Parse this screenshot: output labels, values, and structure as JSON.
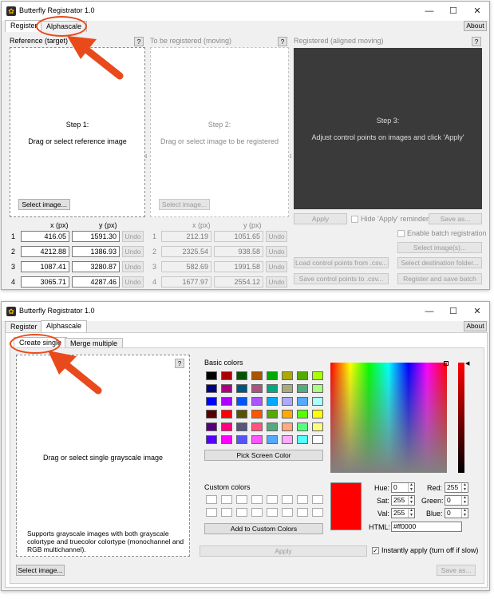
{
  "top": {
    "title": "Butterfly Registrator 1.0",
    "tabs": [
      "Register",
      "Alphascale"
    ],
    "about": "About",
    "help": "?",
    "panels": {
      "reference": {
        "label": "Reference (target)",
        "step": "Step 1:",
        "text": "Drag or select reference image",
        "button": "Select image..."
      },
      "moving": {
        "label": "To be registered (moving)",
        "step": "Step 2:",
        "text": "Drag or select image to be registered",
        "button": "Select image..."
      },
      "registered": {
        "label": "Registered (aligned moving)",
        "step": "Step 3:",
        "text": "Adjust control points on images and click 'Apply'"
      }
    },
    "col_x": "x (px)",
    "col_y": "y (px)",
    "undo": "Undo",
    "ref_points": [
      [
        "416.05",
        "1591.30"
      ],
      [
        "4212.88",
        "1386.93"
      ],
      [
        "1087.41",
        "3280.87"
      ],
      [
        "3065.71",
        "4287.46"
      ]
    ],
    "mov_points": [
      [
        "212.19",
        "1051.65"
      ],
      [
        "2325.54",
        "938.58"
      ],
      [
        "582.69",
        "1991.58"
      ],
      [
        "1677.97",
        "2554.12"
      ]
    ],
    "row_nums": [
      "1",
      "2",
      "3",
      "4"
    ],
    "apply": "Apply",
    "hide_apply": "Hide 'Apply' reminder",
    "save_as": "Save as...",
    "batch_enable": "Enable batch registration",
    "select_images": "Select image(s)...",
    "select_dest": "Select destination folder...",
    "load_cp": "Load control points from .csv...",
    "save_cp": "Save control points to .csv...",
    "register_batch": "Register and save batch"
  },
  "bottom": {
    "title": "Butterfly Registrator 1.0",
    "tabs": [
      "Register",
      "Alphascale"
    ],
    "subtabs": [
      "Create single",
      "Merge multiple"
    ],
    "about": "About",
    "help": "?",
    "drop_text": "Drag or select single grayscale image",
    "support_text": "Supports grayscale images with both grayscale colortype and truecolor colortype (monochannel and RGB multichannel).",
    "select_image": "Select image...",
    "basic_colors": "Basic colors",
    "pick_screen": "Pick Screen Color",
    "custom_colors": "Custom colors",
    "add_custom": "Add to Custom Colors",
    "hue_label": "Hue:",
    "hue": "0",
    "sat_label": "Sat:",
    "sat": "255",
    "val_label": "Val:",
    "val": "255",
    "red_label": "Red:",
    "red": "255",
    "green_label": "Green:",
    "green": "0",
    "blue_label": "Blue:",
    "blue": "0",
    "html_label": "HTML:",
    "html": "#ff0000",
    "apply": "Apply",
    "instant_apply": "Instantly apply (turn off if slow)",
    "save_as": "Save as...",
    "current_color": "#ff0000",
    "basic_swatches": [
      "#000000",
      "#aa0000",
      "#005500",
      "#aa5500",
      "#00aa00",
      "#aaaa00",
      "#55aa00",
      "#aaff00",
      "#00007f",
      "#aa007f",
      "#00557f",
      "#aa557f",
      "#00aa7f",
      "#aaaa7f",
      "#55aa7f",
      "#aaff7f",
      "#0000ff",
      "#aa00ff",
      "#0055ff",
      "#aa55ff",
      "#00aaff",
      "#aaaaff",
      "#55aaff",
      "#aaffff",
      "#550000",
      "#ff0000",
      "#555500",
      "#ff5500",
      "#55aa00",
      "#ffaa00",
      "#55ff00",
      "#ffff00",
      "#55007f",
      "#ff007f",
      "#55557f",
      "#ff557f",
      "#55aa7f",
      "#ffaa7f",
      "#55ff7f",
      "#ffff7f",
      "#5500ff",
      "#ff00ff",
      "#5555ff",
      "#ff55ff",
      "#55aaff",
      "#ffaaff",
      "#55ffff",
      "#ffffff"
    ]
  },
  "accent_color": "#e84a1b"
}
